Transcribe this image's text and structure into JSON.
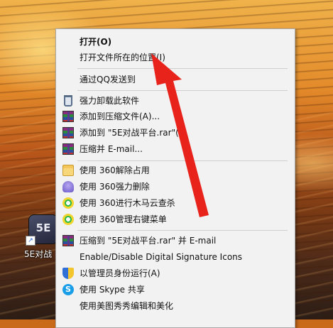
{
  "desktop": {
    "shortcut": {
      "icon_text": "5E",
      "label": "5E对战"
    }
  },
  "context_menu": {
    "items": [
      {
        "label": "打开(O)",
        "icon": "none",
        "bold": true
      },
      {
        "label": "打开文件所在的位置(I)",
        "icon": "none"
      },
      {
        "label": "通过QQ发送到",
        "icon": "none"
      },
      {
        "label": "强力卸载此软件",
        "icon": "trash-icon"
      },
      {
        "label": "添加到压缩文件(A)...",
        "icon": "winrar-icon"
      },
      {
        "label": "添加到 \"5E对战平台.rar\"(",
        "icon": "winrar-icon"
      },
      {
        "label": "压缩并 E-mail...",
        "icon": "winrar-icon"
      },
      {
        "label": "使用 360解除占用",
        "icon": "folder-icon"
      },
      {
        "label": "使用 360强力删除",
        "icon": "shredder-icon"
      },
      {
        "label": "使用 360进行木马云查杀",
        "icon": "360-icon"
      },
      {
        "label": "使用 360管理右键菜单",
        "icon": "360-icon"
      },
      {
        "label": "压缩到 \"5E对战平台.rar\" 并 E-mail",
        "icon": "winrar-icon"
      },
      {
        "label": "Enable/Disable Digital Signature Icons",
        "icon": "none"
      },
      {
        "label": "以管理员身份运行(A)",
        "icon": "uac-shield-icon"
      },
      {
        "label": "使用 Skype 共享",
        "icon": "skype-icon"
      },
      {
        "label": "使用美图秀秀编辑和美化",
        "icon": "none"
      }
    ],
    "skype_glyph": "S"
  },
  "annotation": {
    "arrow_color": "#e8231c"
  }
}
